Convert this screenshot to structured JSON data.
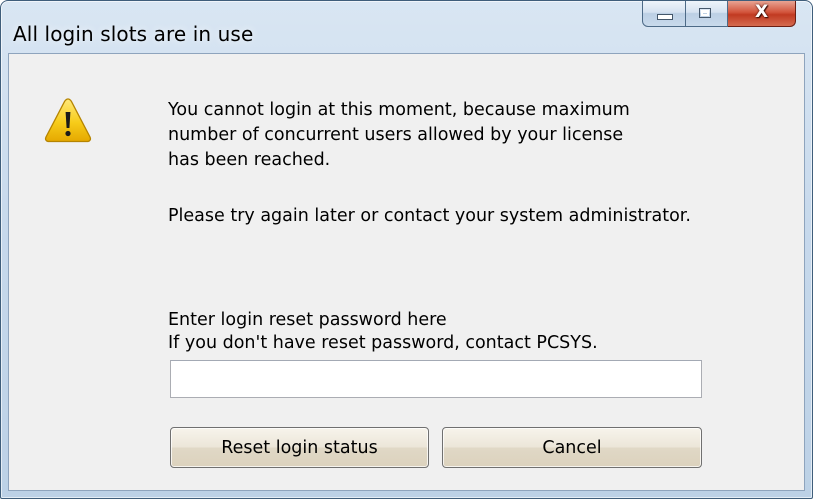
{
  "window": {
    "title": "All login slots are in use",
    "caption_buttons": {
      "minimize_icon": "minimize-icon",
      "maximize_icon": "maximize-icon",
      "close_icon": "close-icon",
      "close_glyph": "X"
    }
  },
  "dialog": {
    "icon": "warning-icon",
    "message_lines": [
      "You cannot login at this moment, because maximum",
      "number of concurrent users allowed by your license",
      "has been reached."
    ],
    "advice": "Please try again later or contact your system administrator.",
    "prompt_lines": [
      "Enter login reset password here",
      "If you don't have reset password, contact PCSYS."
    ],
    "password_value": "",
    "buttons": {
      "reset_label": "Reset login status",
      "cancel_label": "Cancel"
    }
  },
  "colors": {
    "close_button": "#c13a22",
    "warning_yellow": "#f5c400",
    "client_background": "#f0f0f0"
  }
}
